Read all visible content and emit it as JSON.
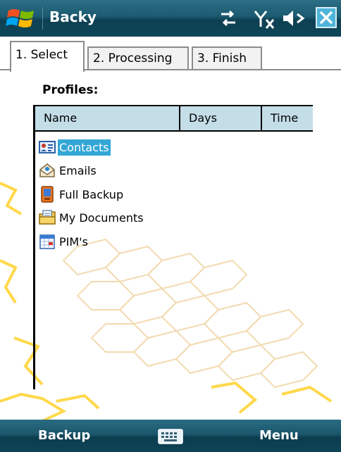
{
  "titlebar": {
    "title": "Backy",
    "icons": [
      "windows-logo",
      "connectivity-arrows-icon",
      "no-signal-icon",
      "speaker-muted-icon",
      "close-icon"
    ]
  },
  "tabs": [
    {
      "label": "1. Select",
      "active": true
    },
    {
      "label": "2. Processing",
      "active": false
    },
    {
      "label": "3. Finish",
      "active": false
    }
  ],
  "profiles": {
    "label": "Profiles:",
    "columns": [
      "Name",
      "Days",
      "Time"
    ],
    "items": [
      {
        "label": "Contacts",
        "icon": "contact-card-icon",
        "selected": true
      },
      {
        "label": "Emails",
        "icon": "envelope-icon",
        "selected": false
      },
      {
        "label": "Full Backup",
        "icon": "pda-device-icon",
        "selected": false
      },
      {
        "label": "My Documents",
        "icon": "documents-folder-icon",
        "selected": false
      },
      {
        "label": "PIM's",
        "icon": "calendar-icon",
        "selected": false
      }
    ]
  },
  "softkeys": {
    "left": "Backup",
    "center_icon": "keyboard-icon",
    "right": "Menu"
  },
  "colors": {
    "titlebar": "#1c5a70",
    "selection": "#33a6d6",
    "header": "#c4dee8"
  }
}
